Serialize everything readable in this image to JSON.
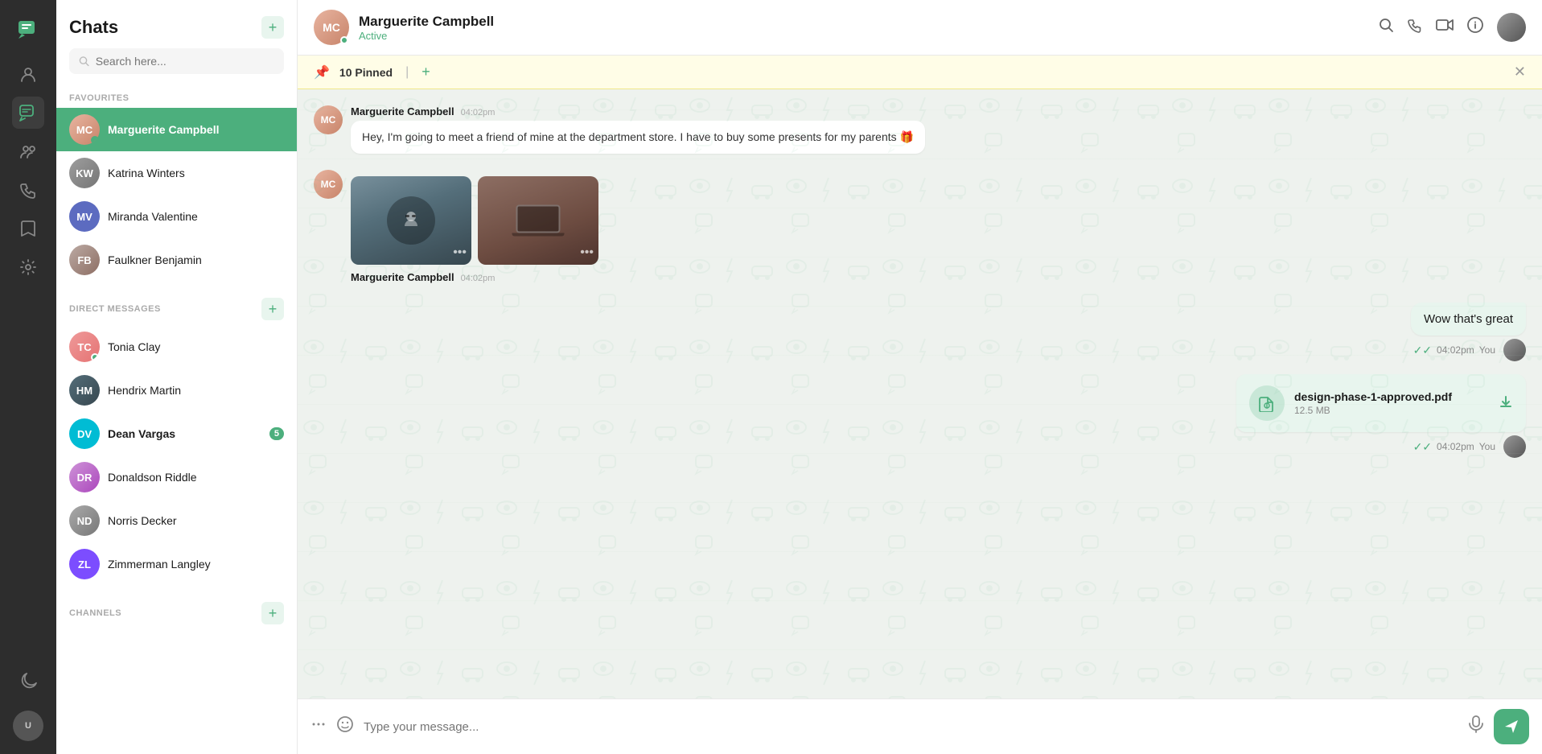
{
  "app": {
    "title": "Chats"
  },
  "sidebar": {
    "title": "Chats",
    "search_placeholder": "Search here...",
    "add_button": "+",
    "sections": {
      "favourites": "FAVOURITES",
      "direct_messages": "DIRECT MESSAGES",
      "channels": "CHANNELS"
    },
    "favourites": [
      {
        "name": "Marguerite Campbell",
        "active": true,
        "online": true,
        "avatar_class": "av-mc",
        "initials": "MC"
      },
      {
        "name": "Katrina Winters",
        "active": false,
        "online": false,
        "avatar_class": "av-kw",
        "initials": "KW"
      },
      {
        "name": "Miranda Valentine",
        "active": false,
        "online": false,
        "avatar_class": "av-mv",
        "initials": "MV"
      },
      {
        "name": "Faulkner Benjamin",
        "active": false,
        "online": false,
        "avatar_class": "av-fb",
        "initials": "FB"
      }
    ],
    "direct_messages": [
      {
        "name": "Tonia Clay",
        "online": true,
        "avatar_class": "av-tc",
        "initials": "TC",
        "badge": null
      },
      {
        "name": "Hendrix Martin",
        "online": false,
        "avatar_class": "av-hm",
        "initials": "HM",
        "badge": null
      },
      {
        "name": "Dean Vargas",
        "online": false,
        "avatar_class": "av-dv",
        "initials": "DV",
        "badge": "5",
        "bold": true
      },
      {
        "name": "Donaldson Riddle",
        "online": false,
        "avatar_class": "av-dr",
        "initials": "DR",
        "badge": null
      },
      {
        "name": "Norris Decker",
        "online": false,
        "avatar_class": "av-nd",
        "initials": "ND",
        "badge": null
      },
      {
        "name": "Zimmerman Langley",
        "online": false,
        "avatar_class": "av-zl",
        "initials": "ZL",
        "badge": null
      }
    ]
  },
  "chat_header": {
    "contact_name": "Marguerite Campbell",
    "status": "Active",
    "pinned_label": "10 Pinned"
  },
  "messages": [
    {
      "id": "msg1",
      "sender": "Marguerite Campbell",
      "time": "04:02pm",
      "text": "Hey, I'm going to meet a friend of mine at the department store. I have to buy some presents for my parents 🎁",
      "side": "left"
    },
    {
      "id": "msg2",
      "sender": "Marguerite Campbell",
      "time": "04:02pm",
      "text": null,
      "has_images": true,
      "side": "left"
    },
    {
      "id": "msg3",
      "text": "Wow that's great",
      "time": "04:02pm",
      "sender_label": "You",
      "side": "right"
    },
    {
      "id": "msg4",
      "file_name": "design-phase-1-approved.pdf",
      "file_size": "12.5 MB",
      "time": "04:02pm",
      "sender_label": "You",
      "side": "right",
      "is_file": true
    }
  ],
  "input": {
    "placeholder": "Type your message..."
  },
  "icons": {
    "search": "🔍",
    "phone": "📞",
    "video": "📹",
    "info": "ℹ",
    "more": "•••",
    "emoji": "🙂",
    "mic": "🎤",
    "send": "➤",
    "pin": "📌",
    "download": "⬇",
    "attachment": "📎",
    "close": "✕",
    "add": "+"
  }
}
